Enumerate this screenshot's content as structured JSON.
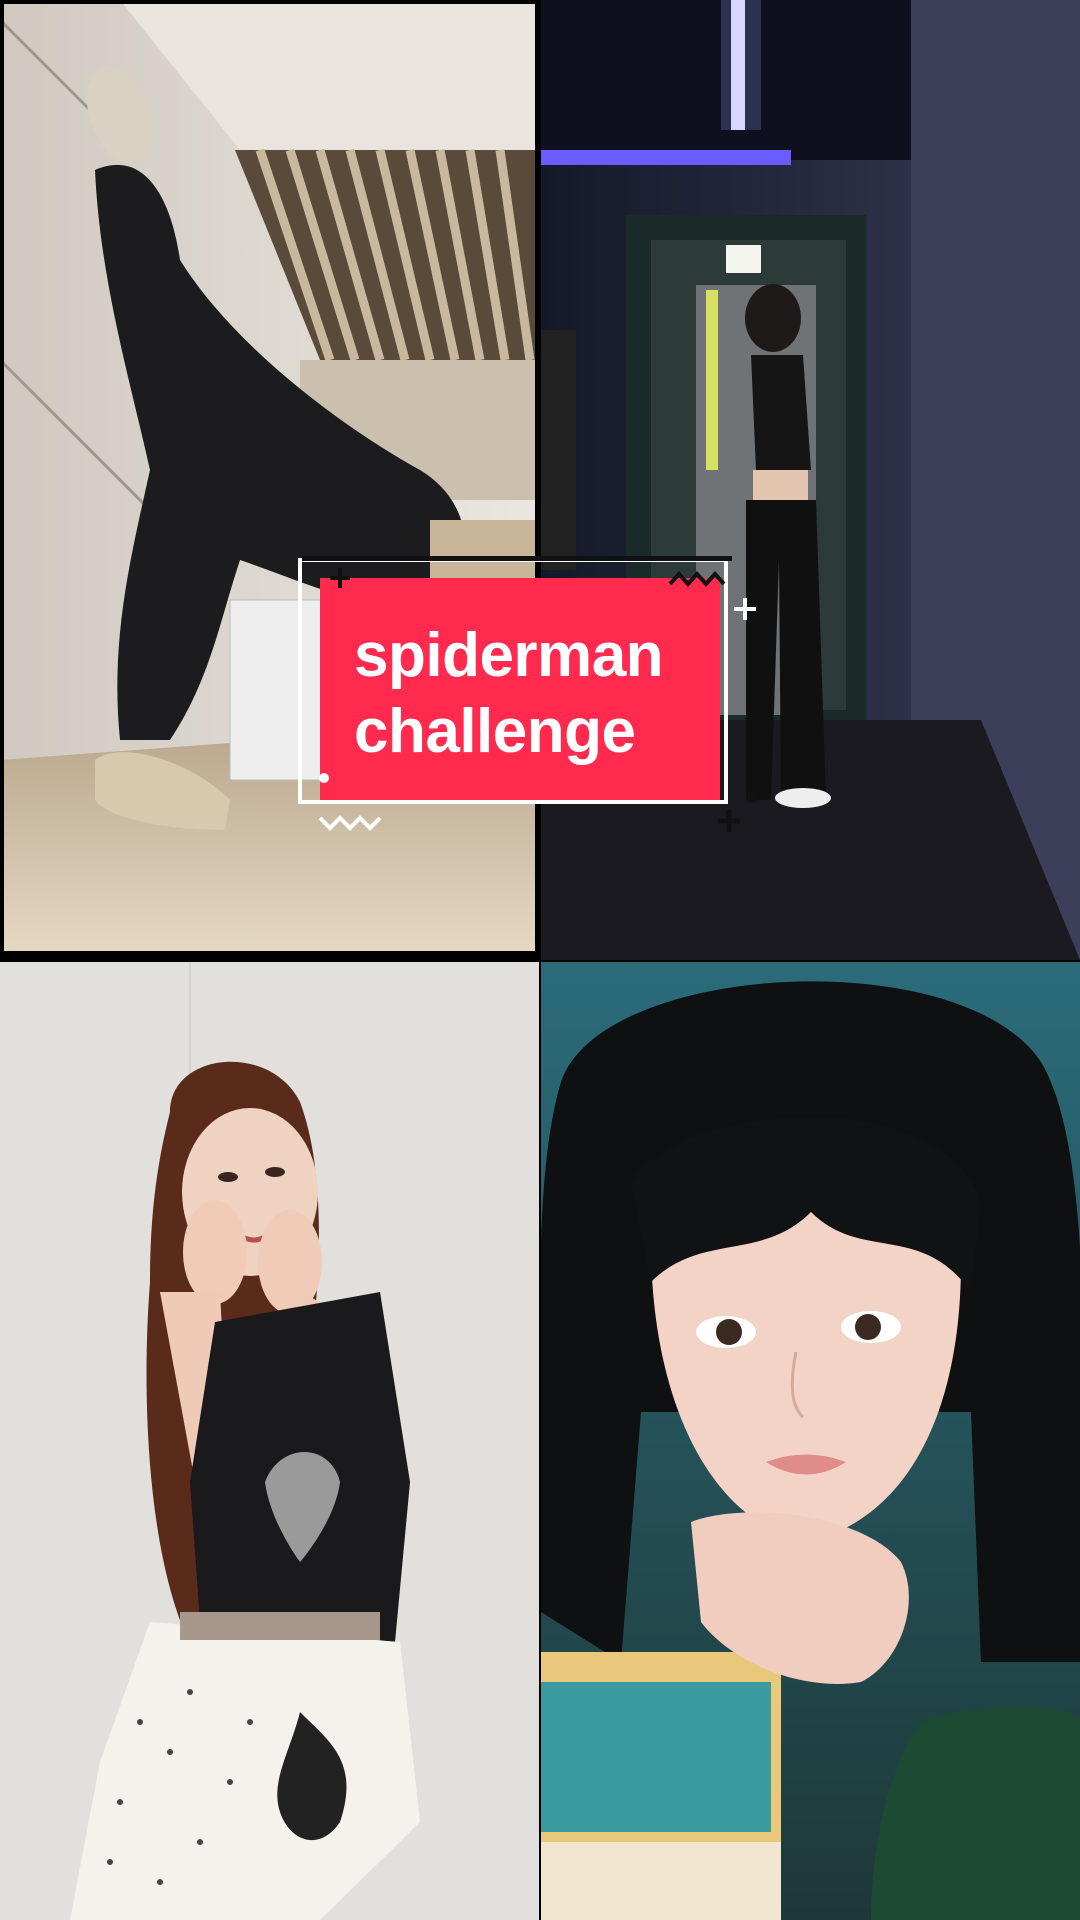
{
  "caption": {
    "line1": "spiderman",
    "line2": "challenge"
  },
  "tiles": [
    {
      "position": "top-left",
      "depiction": "person in black track pants doing a high leg stretch against a wall"
    },
    {
      "position": "top-right",
      "depiction": "person standing in profile in a dim hallway with purple light"
    },
    {
      "position": "bottom-left",
      "depiction": "smiling person with hands on cheeks in black top and patterned skirt"
    },
    {
      "position": "bottom-right",
      "depiction": "close-up portrait of person with dark bangs leaning on books"
    }
  ],
  "colors": {
    "caption_bg": "#ff2a4e",
    "caption_text": "#ffffff"
  }
}
